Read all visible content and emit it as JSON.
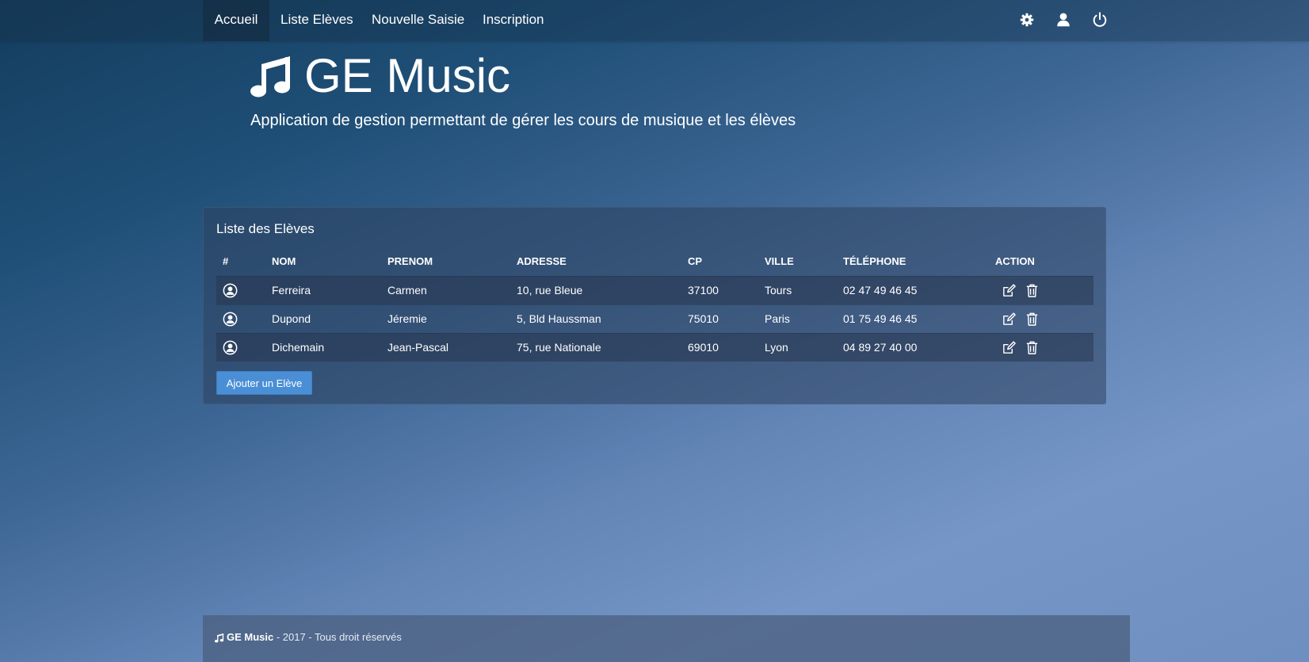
{
  "nav": {
    "items": [
      {
        "label": "Accueil",
        "active": true
      },
      {
        "label": "Liste Elèves",
        "active": false
      },
      {
        "label": "Nouvelle Saisie",
        "active": false
      },
      {
        "label": "Inscription",
        "active": false
      }
    ],
    "icons": [
      "gear-icon",
      "user-icon",
      "power-icon"
    ]
  },
  "hero": {
    "title": "GE Music",
    "subtitle": "Application de gestion permettant de gérer les cours de musique et les élèves",
    "icon": "music-note-icon"
  },
  "panel": {
    "title": "Liste des Elèves",
    "columns": [
      "#",
      "NOM",
      "PRENOM",
      "ADRESSE",
      "CP",
      "VILLE",
      "TÉLÉPHONE",
      "ACTION"
    ],
    "rows": [
      {
        "nom": "Ferreira",
        "prenom": "Carmen",
        "adresse": "10, rue Bleue",
        "cp": "37100",
        "ville": "Tours",
        "telephone": "02 47 49 46 45"
      },
      {
        "nom": "Dupond",
        "prenom": "Jéremie",
        "adresse": "5, Bld Haussman",
        "cp": "75010",
        "ville": "Paris",
        "telephone": "01 75 49 46 45"
      },
      {
        "nom": "Dichemain",
        "prenom": "Jean-Pascal",
        "adresse": "75, rue Nationale",
        "cp": "69010",
        "ville": "Lyon",
        "telephone": "04 89 27 40 00"
      }
    ],
    "row_icons": [
      "user-circle-icon",
      "edit-icon",
      "trash-icon"
    ],
    "add_button": "Ajouter un Elève"
  },
  "footer": {
    "brand": "GE Music",
    "rest": " - 2017 - Tous droit réservés"
  },
  "colors": {
    "button": "#4a8fd6",
    "text": "#ffffff"
  }
}
